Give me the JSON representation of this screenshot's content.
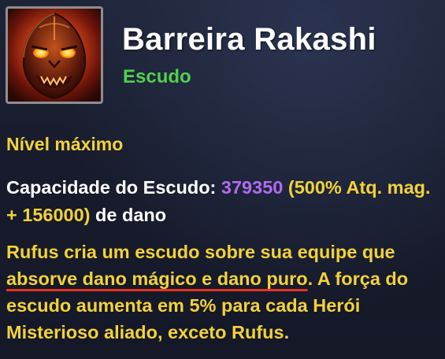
{
  "skill": {
    "icon": "rakashi-barrier-icon",
    "name": "Barreira Rakashi",
    "type": "Escudo"
  },
  "level": {
    "label": "Nível máximo"
  },
  "capacity": {
    "label": "Capacidade do Escudo:",
    "value": "379350",
    "bonus": "(500% Atq. mag. + 156000)",
    "suffix": "de dano"
  },
  "description": {
    "line_start": "Rufus cria um escudo sobre sua equipe que",
    "highlight": "absorve dano mágico e dano puro",
    "line_end": ". A força do escudo aumenta em 5% para cada Herói Misterioso aliado, exceto Rufus."
  },
  "colors": {
    "title": "#ffffff",
    "type": "#4fd14b",
    "gold": "#f2d23a",
    "value": "#b06cf0",
    "underline": "#e8321e"
  }
}
